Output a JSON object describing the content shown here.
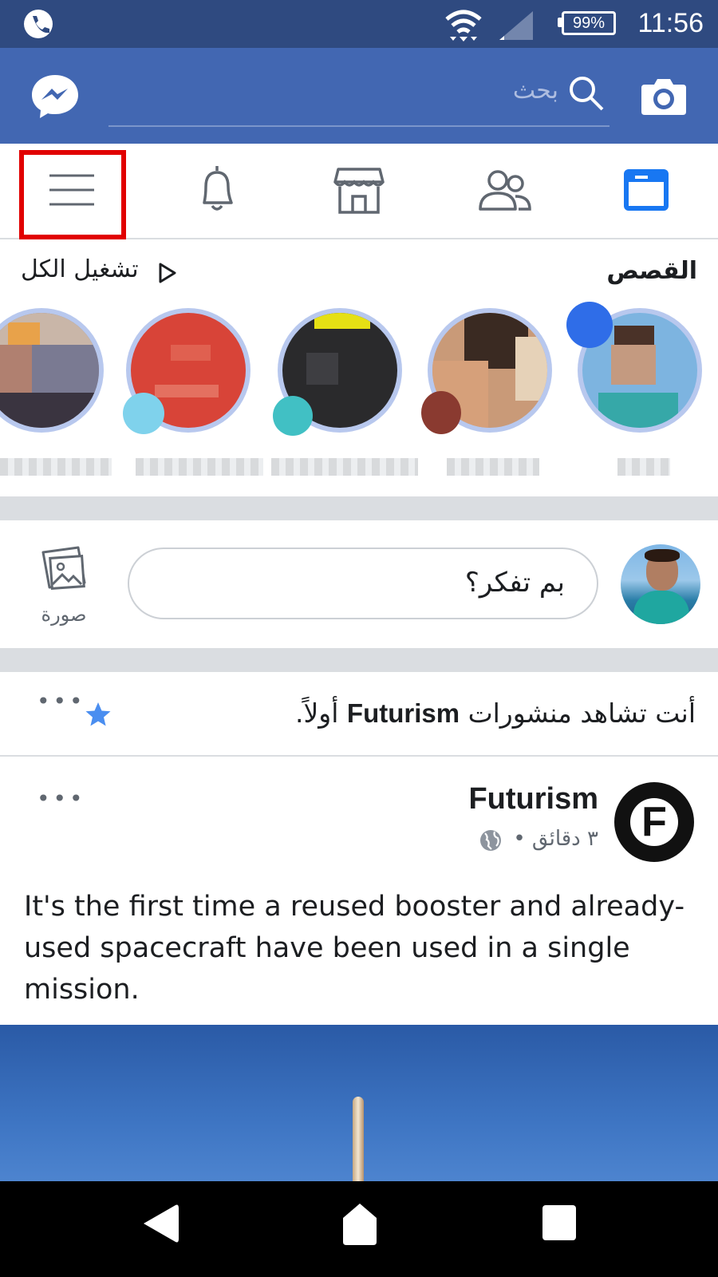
{
  "status_bar": {
    "battery": "99%",
    "time": "11:56"
  },
  "header": {
    "search_placeholder": "بحث"
  },
  "stories": {
    "title": "القصص",
    "play_all": "تشغيل الكل"
  },
  "composer": {
    "placeholder": "بم تفكر؟",
    "photo_label": "صورة"
  },
  "see_first": {
    "prefix": "أنت تشاهد منشورات ",
    "page_name": "Futurism",
    "suffix": " أولاً."
  },
  "post": {
    "author": "Futurism",
    "logo_letter": "F",
    "time": "٣ دقائق •",
    "text": "It's the first time a reused booster and already-used spacecraft have been used in a single mission."
  },
  "colors": {
    "brand_blue": "#4267b2",
    "status_bar": "#2f4a80",
    "highlight_red": "#e10000"
  },
  "icons": {
    "header": [
      "messenger-icon",
      "search-icon",
      "camera-icon"
    ],
    "tabs": [
      "menu-icon",
      "notifications-icon",
      "marketplace-icon",
      "friends-icon",
      "news-feed-icon"
    ]
  }
}
